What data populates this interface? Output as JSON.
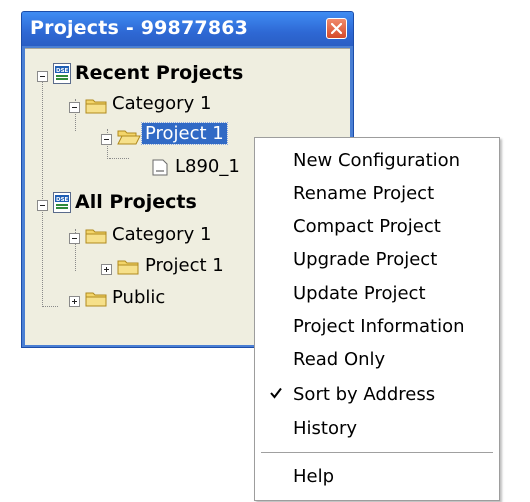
{
  "window": {
    "title": "Projects - 99877863",
    "close_icon": "close-icon"
  },
  "tree": {
    "recent_label": "Recent Projects",
    "recent_category": "Category 1",
    "recent_project": "Project 1",
    "recent_file": "L890_1",
    "all_label": "All Projects",
    "all_category": "Category 1",
    "all_project": "Project 1",
    "public_label": "Public",
    "selected_item": "Project 1"
  },
  "context_menu": {
    "items": [
      {
        "label": "New Configuration",
        "checked": false
      },
      {
        "label": "Rename Project",
        "checked": false
      },
      {
        "label": "Compact Project",
        "checked": false
      },
      {
        "label": "Upgrade Project",
        "checked": false
      },
      {
        "label": "Update Project",
        "checked": false
      },
      {
        "label": "Project Information",
        "checked": false
      },
      {
        "label": "Read Only",
        "checked": false
      },
      {
        "label": "Sort by Address",
        "checked": true
      },
      {
        "label": "History",
        "checked": false
      }
    ],
    "help_label": "Help"
  },
  "colors": {
    "titlebar": "#2e68d4",
    "tree_background": "#efeee0",
    "selection": "#316ac5",
    "close_button": "#d64a2a"
  }
}
